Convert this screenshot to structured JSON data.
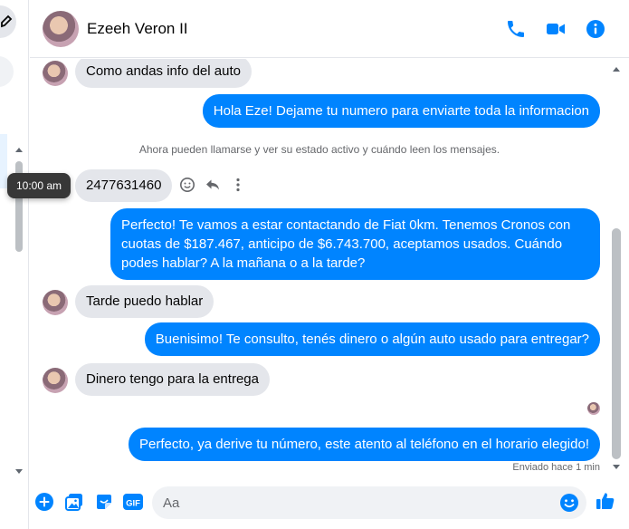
{
  "conversation": {
    "contact_name": "Ezeeh Veron II"
  },
  "colors": {
    "accent": "#0084ff",
    "incoming_bubble": "#e4e6eb"
  },
  "header_icons": [
    "phone-icon",
    "video-call-icon",
    "info-icon"
  ],
  "messages": {
    "m1": "Como andas info del auto",
    "m2": "Hola Eze! Dejame tu numero para enviarte toda la informacion",
    "notice": "Ahora pueden llamarse y ver su estado activo y cuándo leen los mensajes.",
    "m3": "2477631460",
    "m4": "Perfecto! Te vamos a estar contactando de Fiat 0km. Tenemos Cronos con cuotas de $187.467, anticipo de $6.743.700, aceptamos usados. Cuándo podes hablar? A la mañana o a la tarde?",
    "m5": "Tarde puedo hablar",
    "m6": "Buenisimo! Te consulto, tenés dinero o algún auto usado para entregar?",
    "m7": "Dinero tengo para la entrega",
    "m8": "Perfecto, ya derive tu número, este atento al teléfono en el horario elegido!",
    "sent_status": "Enviado hace 1 min"
  },
  "tooltip": {
    "time": "10:00 am"
  },
  "message_actions": [
    "react-icon",
    "reply-icon",
    "more-icon"
  ],
  "composer": {
    "placeholder": "Aa",
    "icons": [
      "add-icon",
      "photo-icon",
      "sticker-icon",
      "gif-icon",
      "emoji-icon",
      "like-icon"
    ]
  }
}
